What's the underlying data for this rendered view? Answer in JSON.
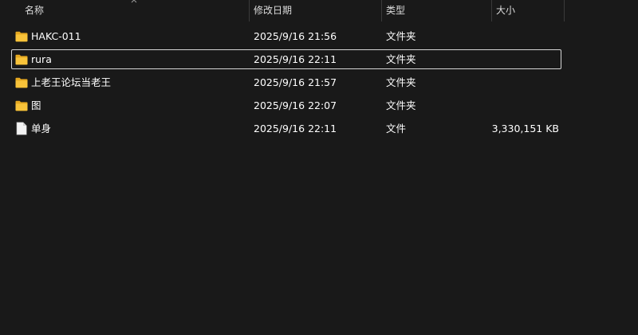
{
  "columns": {
    "name": "名称",
    "date": "修改日期",
    "type": "类型",
    "size": "大小"
  },
  "files": [
    {
      "name": "HAKC-011",
      "date": "2025/9/16 21:56",
      "type": "文件夹",
      "size": "",
      "icon": "folder-icon",
      "selected": false
    },
    {
      "name": "rura",
      "date": "2025/9/16 22:11",
      "type": "文件夹",
      "size": "",
      "icon": "folder-icon",
      "selected": true
    },
    {
      "name": "上老王论坛当老王",
      "date": "2025/9/16 21:57",
      "type": "文件夹",
      "size": "",
      "icon": "folder-icon",
      "selected": false
    },
    {
      "name": "图",
      "date": "2025/9/16 22:07",
      "type": "文件夹",
      "size": "",
      "icon": "folder-icon",
      "selected": false
    },
    {
      "name": "单身",
      "date": "2025/9/16 22:11",
      "type": "文件",
      "size": "3,330,151 KB",
      "icon": "file-icon",
      "selected": false
    }
  ],
  "colors": {
    "background": "#191919",
    "folder": "#f8c33a",
    "folder_dark": "#e5a820",
    "file": "#f2f2f2",
    "selection_border": "#d6d6d6"
  }
}
